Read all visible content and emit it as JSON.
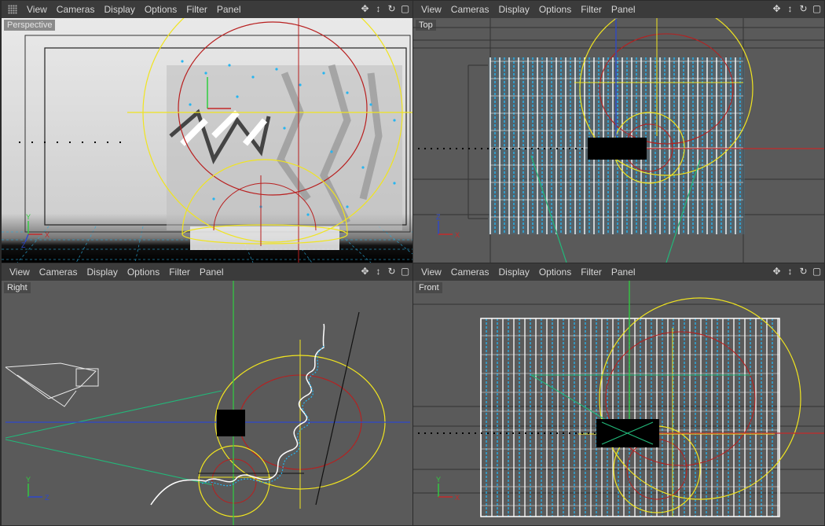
{
  "menu": {
    "view": "View",
    "cameras": "Cameras",
    "display": "Display",
    "options": "Options",
    "filter": "Filter",
    "panel": "Panel"
  },
  "viewports": {
    "perspective": {
      "label": "Perspective"
    },
    "top": {
      "label": "Top"
    },
    "right": {
      "label": "Right"
    },
    "front": {
      "label": "Front"
    }
  },
  "icons": {
    "move": "move-view-icon",
    "dolly": "dolly-icon",
    "rotate": "rotate-view-icon",
    "maximize": "maximize-view-icon",
    "grip": "panel-grip-icon"
  },
  "colors": {
    "viewport_bg": "#5a5a5a",
    "menubar": "#3b3b3b",
    "spline": "#ffffff",
    "points": "#26b5f0",
    "bound": "#f0e420",
    "circle": "#b81f1f",
    "x_axis": "#c42a2a",
    "y_axis": "#2fcf3f",
    "z_axis": "#2d47cc",
    "camera_line": "#22b87a"
  },
  "axes": {
    "x": "X",
    "y": "Y",
    "z": "Z"
  }
}
